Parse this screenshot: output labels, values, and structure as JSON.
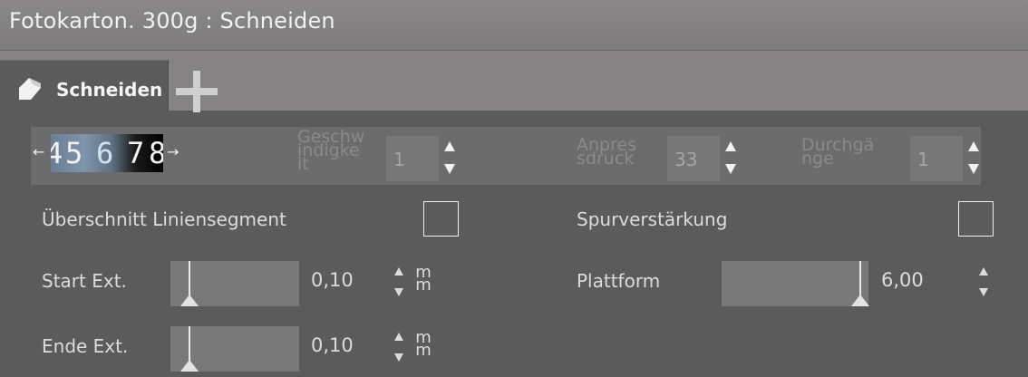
{
  "window": {
    "title": "Fotokarton. 300g : Schneiden"
  },
  "tabs": [
    {
      "label": "Schneiden",
      "icon": "blade-icon",
      "active": true
    }
  ],
  "add_tab": {
    "icon": "plus-icon"
  },
  "toolrow": {
    "digits": [
      "4",
      "5",
      "6",
      "7",
      "8"
    ],
    "speed": {
      "label_lines": [
        "Geschw",
        "indigke",
        "it"
      ],
      "value": "1"
    },
    "pressure": {
      "label_lines": [
        "Anpres",
        "sdruck"
      ],
      "value": "33"
    },
    "passes": {
      "label_lines": [
        "Durchgä",
        "nge"
      ],
      "value": "1"
    }
  },
  "options": {
    "overcut": {
      "label": "Überschnitt Liniensegment",
      "checked": false
    },
    "track_enhance": {
      "label": "Spurverstärkung",
      "checked": false
    }
  },
  "start_ext": {
    "label": "Start Ext.",
    "value": "0,10",
    "unit": [
      "m",
      "m"
    ]
  },
  "end_ext": {
    "label": "Ende Ext.",
    "value": "0,10",
    "unit": [
      "m",
      "m"
    ]
  },
  "platform": {
    "label": "Plattform",
    "value": "6,00"
  },
  "colors": {
    "panel": "#5c5b5b",
    "title_bar": "#858383",
    "field": "#787777"
  }
}
